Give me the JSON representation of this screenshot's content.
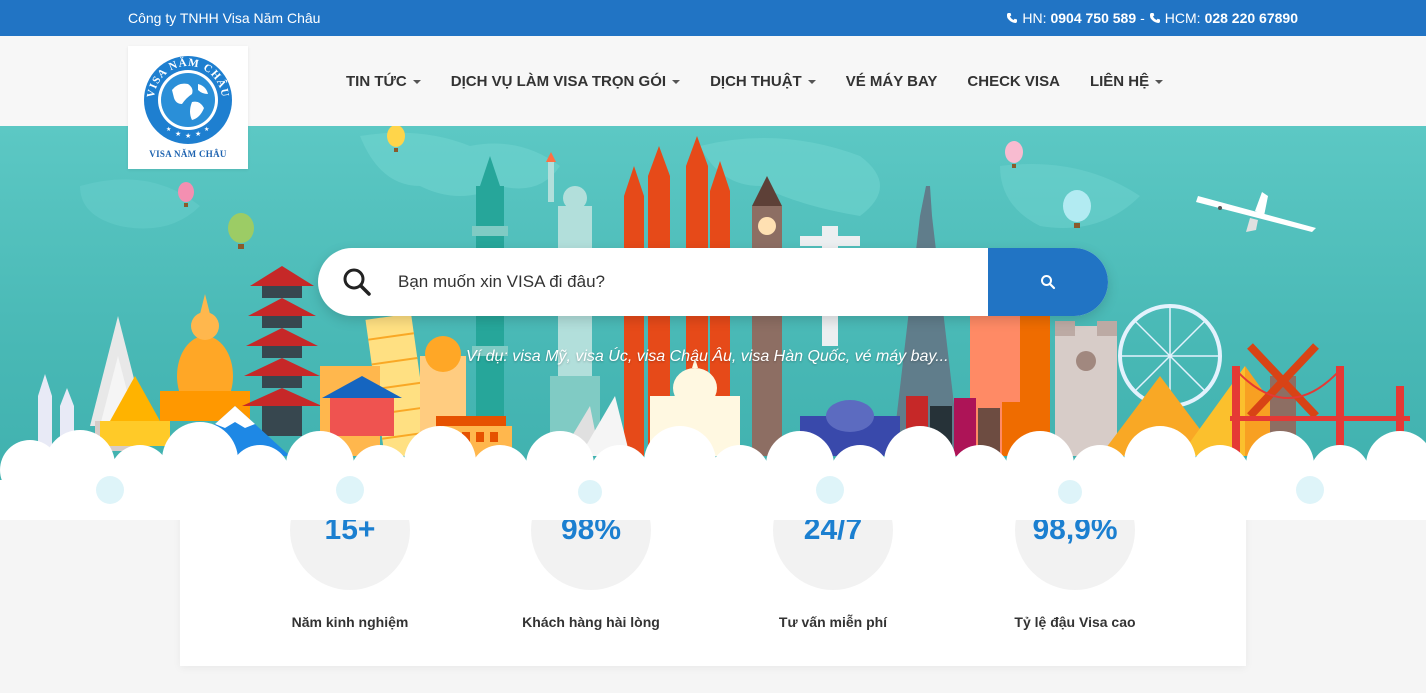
{
  "topbar": {
    "company": "Công ty TNHH Visa Năm Châu",
    "hn_label": "HN:",
    "hn_phone": "0904 750 589",
    "separator": "-",
    "hcm_label": "HCM:",
    "hcm_phone": "028 220 67890"
  },
  "logo": {
    "arc_text": "VISA NĂM CHÂU",
    "bottom_text": "VISA NĂM CHÂU"
  },
  "menu": {
    "items": [
      {
        "label": "TIN TỨC",
        "dropdown": true
      },
      {
        "label": "DỊCH VỤ LÀM VISA TRỌN GÓI",
        "dropdown": true
      },
      {
        "label": "DỊCH THUẬT",
        "dropdown": true
      },
      {
        "label": "VÉ MÁY BAY",
        "dropdown": false
      },
      {
        "label": "CHECK VISA",
        "dropdown": false
      },
      {
        "label": "LIÊN HỆ",
        "dropdown": true
      }
    ]
  },
  "search": {
    "placeholder": "Bạn muốn xin VISA đi đâu?",
    "hint": "Ví dụ: visa Mỹ, visa Úc, visa Châu Âu, visa Hàn Quốc, vé máy bay..."
  },
  "stats": [
    {
      "value": "15+",
      "label": "Năm kinh nghiệm"
    },
    {
      "value": "98%",
      "label": "Khách hàng hài lòng"
    },
    {
      "value": "24/7",
      "label": "Tư vấn miễn phí"
    },
    {
      "value": "98,9%",
      "label": "Tỷ lệ đậu Visa cao"
    }
  ],
  "colors": {
    "primary": "#2174c4",
    "stat_number": "#1b7fd0",
    "hero_bg": "#4fbfbc"
  },
  "icons": [
    "phone-icon",
    "search-icon",
    "caret-down-icon",
    "globe-logo-icon"
  ]
}
